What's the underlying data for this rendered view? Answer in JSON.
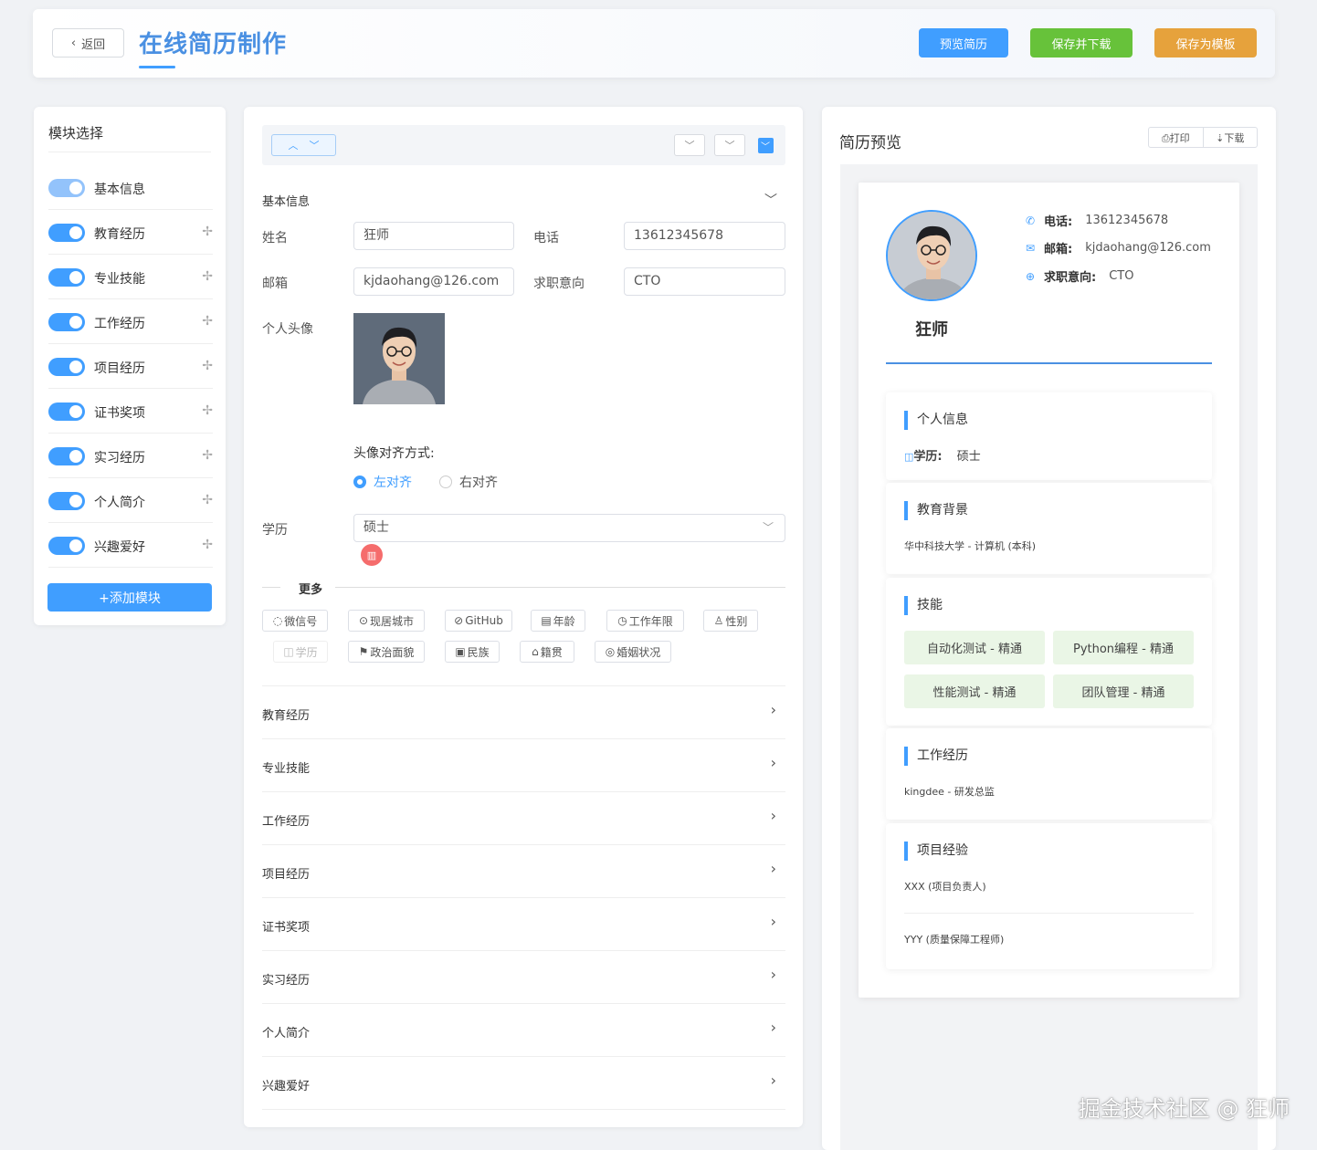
{
  "header": {
    "back_label": "返回",
    "title": "在线简历制作",
    "buttons": [
      {
        "label": "预览简历",
        "color": "#409eff"
      },
      {
        "label": "保存并下载",
        "color": "#67c23a"
      },
      {
        "label": "保存为模板",
        "color": "#e6a23c"
      }
    ]
  },
  "left": {
    "title": "模块选择",
    "modules": [
      {
        "label": "基本信息",
        "on": true
      },
      {
        "label": "教育经历",
        "on": true
      },
      {
        "label": "专业技能",
        "on": true
      },
      {
        "label": "工作经历",
        "on": true
      },
      {
        "label": "项目经历",
        "on": true
      },
      {
        "label": "证书奖项",
        "on": true
      },
      {
        "label": "实习经历",
        "on": true
      },
      {
        "label": "个人简介",
        "on": true
      },
      {
        "label": "兴趣爱好",
        "on": true
      }
    ],
    "add_label": "+添加模块"
  },
  "form": {
    "section_title": "基本信息",
    "fields": {
      "name": {
        "label": "姓名",
        "value": "狂师"
      },
      "phone": {
        "label": "电话",
        "value": "13612345678"
      },
      "email": {
        "label": "邮箱",
        "value": "kjdaohang@126.com"
      },
      "intent": {
        "label": "求职意向",
        "value": "CTO"
      },
      "avatar": {
        "label": "个人头像"
      },
      "align": {
        "label": "头像对齐方式:",
        "options": [
          "左对齐",
          "右对齐"
        ],
        "selected": "左对齐"
      },
      "edu": {
        "label": "学历",
        "value": "硕士"
      }
    },
    "more_label": "更多",
    "chips": [
      {
        "icon": "◌",
        "label": "微信号",
        "disabled": false
      },
      {
        "icon": "⊙",
        "label": "现居城市",
        "disabled": false
      },
      {
        "icon": "⊘",
        "label": "GitHub",
        "disabled": false
      },
      {
        "icon": "▤",
        "label": "年龄",
        "disabled": false
      },
      {
        "icon": "◷",
        "label": "工作年限",
        "disabled": false
      },
      {
        "icon": "♙",
        "label": "性别",
        "disabled": false
      },
      {
        "icon": "◫",
        "label": "学历",
        "disabled": true
      },
      {
        "icon": "⚑",
        "label": "政治面貌",
        "disabled": false
      },
      {
        "icon": "▣",
        "label": "民族",
        "disabled": false
      },
      {
        "icon": "⌂",
        "label": "籍贯",
        "disabled": false
      },
      {
        "icon": "◎",
        "label": "婚姻状况",
        "disabled": false
      }
    ],
    "sections": [
      "教育经历",
      "专业技能",
      "工作经历",
      "项目经历",
      "证书奖项",
      "实习经历",
      "个人简介",
      "兴趣爱好"
    ]
  },
  "preview": {
    "title": "简历预览",
    "print_label": "⎙打印",
    "download_label": "⇣下载",
    "name": "狂师",
    "contacts": [
      {
        "icon": "✆",
        "label": "电话:",
        "value": "13612345678"
      },
      {
        "icon": "✉",
        "label": "邮箱:",
        "value": "kjdaohang@126.com"
      },
      {
        "icon": "⊕",
        "label": "求职意向:",
        "value": "CTO"
      }
    ],
    "personal": {
      "title": "个人信息",
      "edu_label": "学历:",
      "edu_value": "硕士"
    },
    "education": {
      "title": "教育背景",
      "item": "华中科技大学 - 计算机 (本科)"
    },
    "skills": {
      "title": "技能",
      "items": [
        "自动化测试 - 精通",
        "Python编程 - 精通",
        "性能测试 - 精通",
        "团队管理 - 精通"
      ]
    },
    "work": {
      "title": "工作经历",
      "item": "kingdee - 研发总监"
    },
    "projects": {
      "title": "项目经验",
      "items": [
        "XXX (项目负责人)",
        "YYY (质量保障工程师)"
      ]
    }
  },
  "watermark": "掘金技术社区 @ 狂师"
}
